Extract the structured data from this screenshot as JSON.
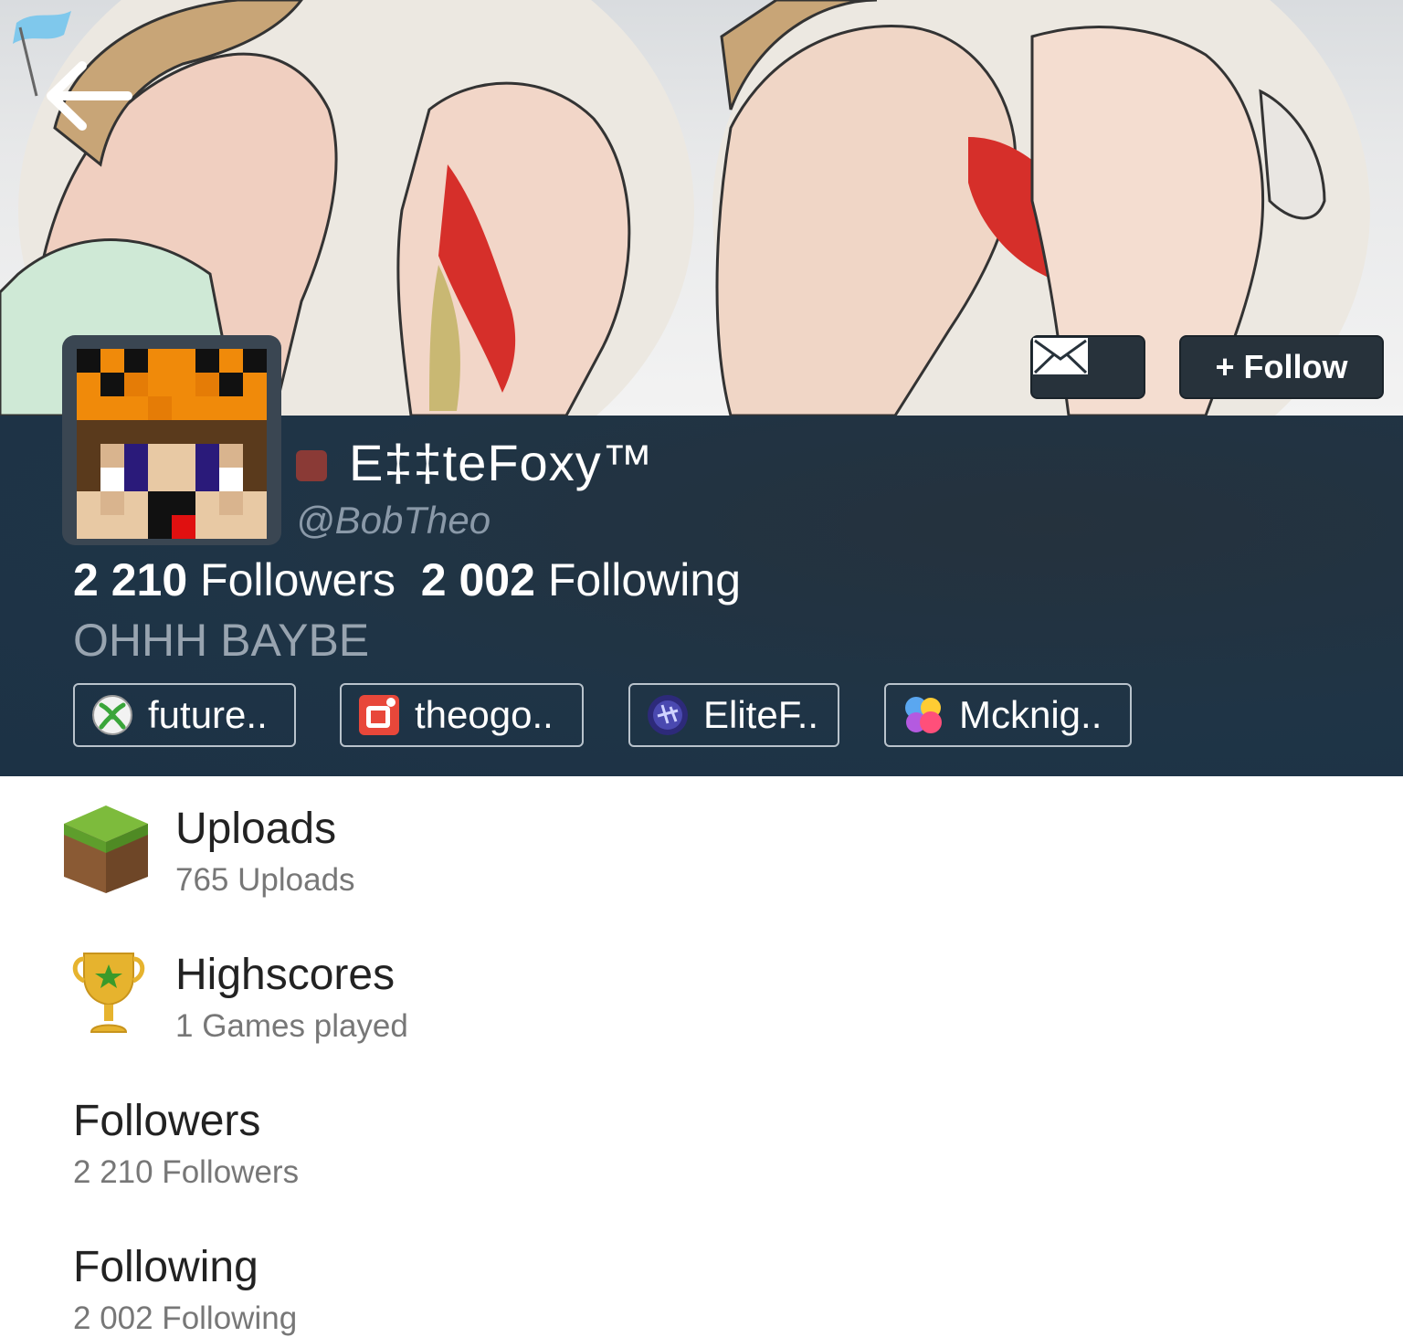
{
  "header": {
    "back_icon": "arrow-left-icon",
    "flag_icon": "flag-icon",
    "mail_icon": "envelope-icon",
    "follow_label": "+ Follow"
  },
  "profile": {
    "display_name": "E‡‡teFoxy™",
    "handle": "@BobTheo",
    "status_color": "#8a3a36",
    "followers_count": "2 210",
    "followers_label": "Followers",
    "following_count": "2 002",
    "following_label": "Following",
    "bio": "OHHH BAYBE"
  },
  "accounts": [
    {
      "icon": "xbox-icon",
      "label": "future.."
    },
    {
      "icon": "game-center-app-icon",
      "label": "theogo.."
    },
    {
      "icon": "playstation-icon",
      "label": "EliteF.."
    },
    {
      "icon": "game-center-bubbles-icon",
      "label": "Mcknig.."
    }
  ],
  "menu": [
    {
      "icon": "minecraft-block-icon",
      "title": "Uploads",
      "subtitle": "765 Uploads"
    },
    {
      "icon": "trophy-icon",
      "title": "Highscores",
      "subtitle": "1 Games played"
    },
    {
      "title": "Followers",
      "subtitle": "2 210 Followers"
    },
    {
      "title": "Following",
      "subtitle": "2 002 Following"
    }
  ],
  "colors": {
    "band": "#1f3446",
    "button_bg": "#27323b",
    "accent_red": "#d93a2e"
  }
}
